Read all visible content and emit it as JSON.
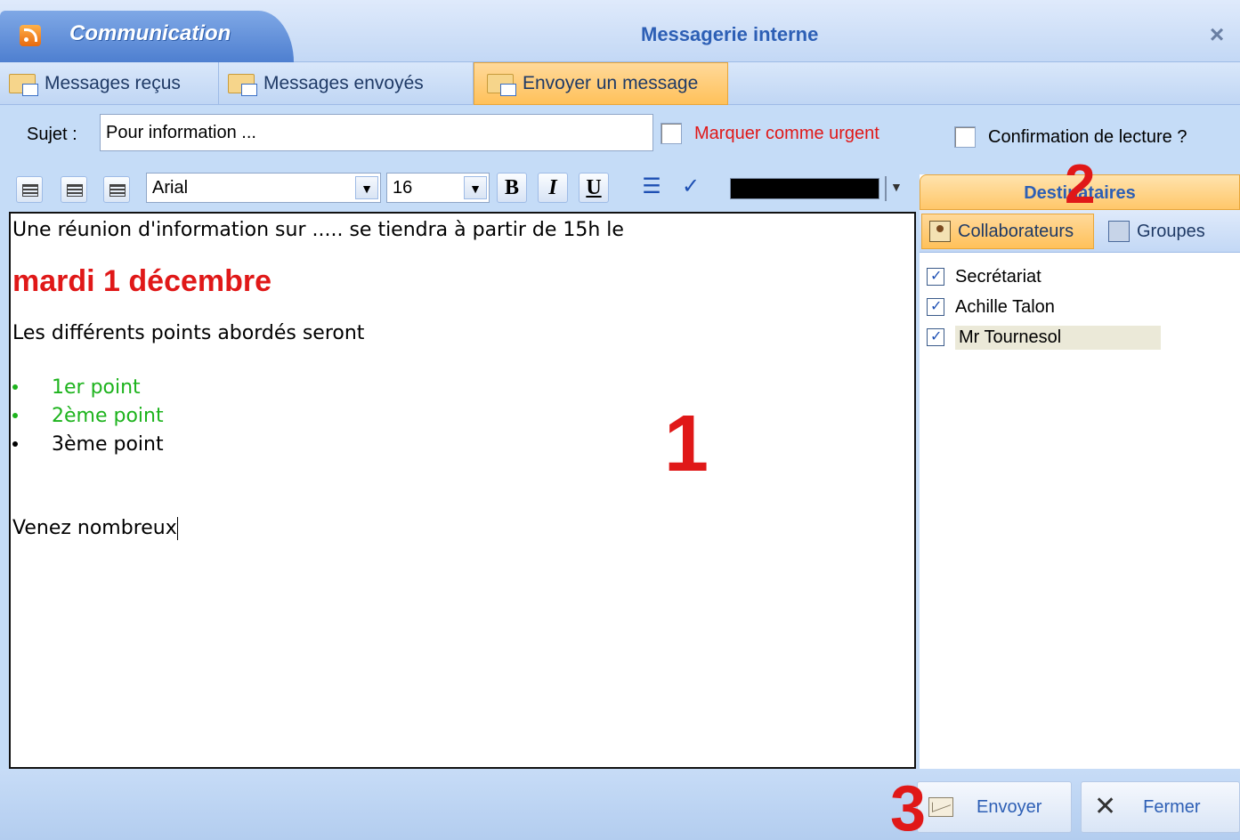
{
  "titlebar": {
    "app_name": "Communication",
    "window_title": "Messagerie interne",
    "close": "×"
  },
  "tabs": [
    {
      "label": "Messages reçus",
      "icon": "inbox-icon"
    },
    {
      "label": "Messages envoyés",
      "icon": "sent-icon"
    },
    {
      "label": "Envoyer un message",
      "icon": "compose-icon",
      "active": true
    }
  ],
  "subject": {
    "label": "Sujet :",
    "value": "Pour information ..."
  },
  "options": {
    "urgent_label": "Marquer comme urgent",
    "confirm_label": "Confirmation de lecture ?"
  },
  "toolbar": {
    "font_name": "Arial",
    "font_size": "16",
    "bold": "B",
    "italic": "I",
    "underline": "U",
    "text_color": "#000000"
  },
  "editor": {
    "line1": "Une réunion d'information sur ..... se tiendra à partir de 15h le",
    "date": "mardi 1 décembre",
    "line3": "Les différents points abordés seront",
    "bullets": [
      {
        "text": "1er point",
        "color": "#1db31d"
      },
      {
        "text": "2ème point",
        "color": "#1db31d"
      },
      {
        "text": "3ème point",
        "color": "#000000"
      }
    ],
    "closing": "Venez nombreux"
  },
  "recipients_panel": {
    "header": "Destinataires",
    "subtabs": [
      {
        "label": "Collaborateurs",
        "icon": "person-icon",
        "active": true
      },
      {
        "label": "Groupes",
        "icon": "group-icon"
      }
    ],
    "recipients": [
      {
        "name": "Secrétariat",
        "checked": true
      },
      {
        "name": "Achille Talon",
        "checked": true
      },
      {
        "name": "Mr Tournesol",
        "checked": true,
        "selected": true
      }
    ]
  },
  "actions": {
    "send_label": "Envoyer",
    "close_label": "Fermer"
  },
  "markers": {
    "editor": "1",
    "recipients": "2",
    "send": "3"
  }
}
